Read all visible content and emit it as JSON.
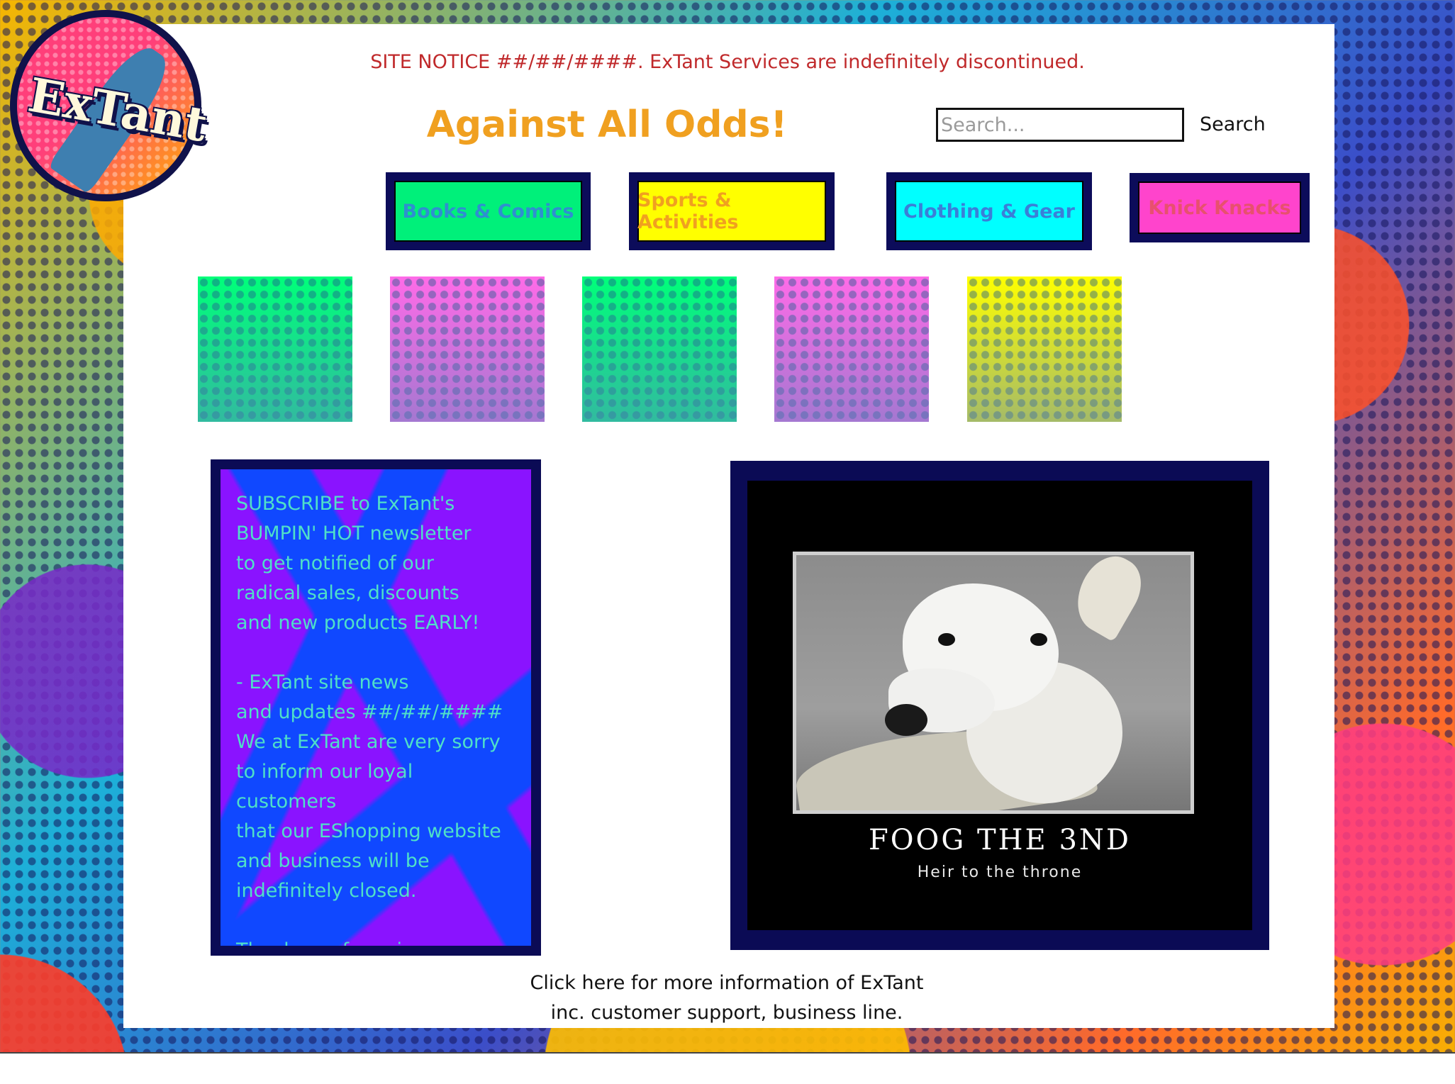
{
  "logo": {
    "text": "ExTant"
  },
  "notice": "SITE NOTICE ##/##/####. ExTant Services are indefinitely discontinued.",
  "title": "Against All Odds!",
  "search": {
    "placeholder": "Search...",
    "button_label": "Search"
  },
  "nav": [
    {
      "label": "Books & Comics",
      "bg": "#00f07a",
      "color": "#2f8fd0"
    },
    {
      "label": "Sports & Activities",
      "bg": "#ffff00",
      "color": "#f0a020"
    },
    {
      "label": "Clothing & Gear",
      "bg": "#00ffff",
      "color": "#3a7fd8"
    },
    {
      "label": "Knick Knacks",
      "bg": "#ff44cc",
      "color": "#e8506e"
    }
  ],
  "tiles": [
    {
      "color": "#00ff7a"
    },
    {
      "color": "#ff6be8"
    },
    {
      "color": "#00ff7a"
    },
    {
      "color": "#ff6be8"
    },
    {
      "color": "#ffff00"
    }
  ],
  "newsletter": {
    "text": "SUBSCRIBE to ExTant's\nBUMPIN' HOT newsletter\nto get notified of our\nradical sales, discounts\nand new products EARLY!\n\n- ExTant site news\nand updates ##/##/####\nWe at ExTant are very sorry\nto inform our loyal customers\nthat our EShopping website\nand business will be\nindefinitely closed.\n\nThank you for using our se..."
  },
  "poster": {
    "title": "FOOG THE 3ND",
    "subtitle": "Heir to the throne"
  },
  "footer": {
    "link_text": "Click here for more information of ExTant\ninc. customer support, business line."
  },
  "colors": {
    "notice": "#c0292b",
    "title": "#f0a020",
    "border_navy": "#0b0b55",
    "newsletter_purple": "#8a13ff",
    "newsletter_blue": "#1048ff"
  }
}
